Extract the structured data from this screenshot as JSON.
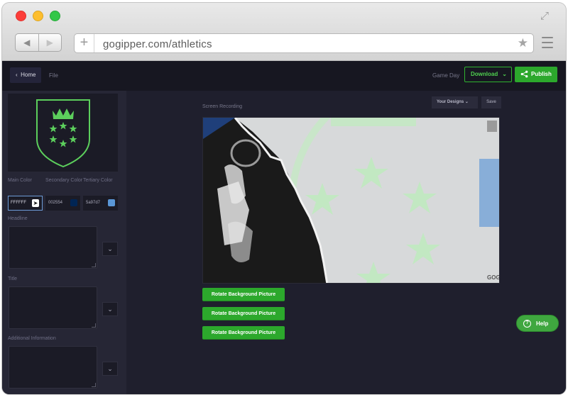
{
  "browser": {
    "url": "gogipper.com/athletics"
  },
  "topbar": {
    "home_label": "Home",
    "file_label": "File",
    "template_name": "Game Day",
    "download_label": "Download",
    "publish_label": "Publish"
  },
  "sidebar": {
    "color_labels": [
      "Main Color",
      "Secondary Color",
      "Tertiary Color"
    ],
    "colors": [
      {
        "value": "FFFFFF",
        "hex": "#FFFFFF"
      },
      {
        "value": "002554",
        "hex": "#002554"
      },
      {
        "value": "5a97d7",
        "hex": "#5a97d7"
      }
    ],
    "fields": {
      "headline": "Headline",
      "title": "Title",
      "additional": "Additional Information"
    }
  },
  "main": {
    "screen_recording": "Screen Recording",
    "designs_label": "Your Designs",
    "save_label": "Save",
    "rotate_buttons": [
      "Rotate Background Picture",
      "Rotate Background Picture",
      "Rotate Background Picture"
    ],
    "watermark": "GOGIPPER"
  },
  "help_label": "Help",
  "colors": {
    "accent": "#2ca82c",
    "logo_green": "#5ccf5c",
    "background": "#1f1f2d"
  }
}
